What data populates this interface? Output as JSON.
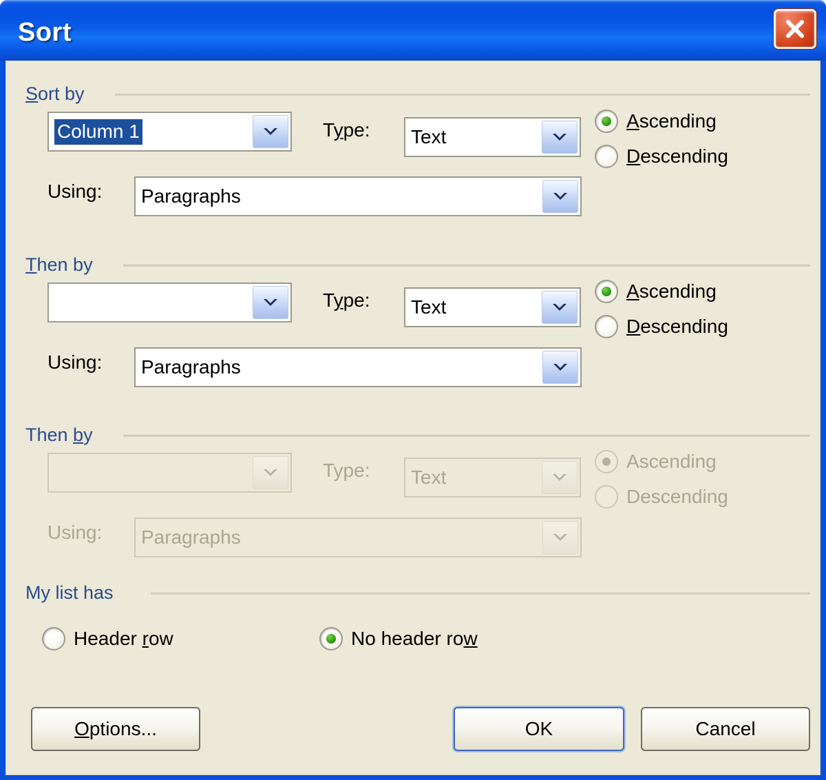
{
  "window": {
    "title": "Sort",
    "close_icon": "close-icon"
  },
  "groups": {
    "sort_by": {
      "label_pre": "S",
      "label_post": "ort by",
      "field_value": "Column 1",
      "field_selected": true,
      "type_label_pre": "T",
      "type_label_mid": "y",
      "type_label_post": "pe:",
      "type_value": "Text",
      "using_label": "Using:",
      "using_value": "Paragraphs",
      "ascending_pre": "A",
      "ascending_post": "scending",
      "descending_pre": "D",
      "descending_post": "escending",
      "order_selected": "Ascending"
    },
    "then_by_1": {
      "label_pre": "T",
      "label_post": "hen by",
      "field_value": "",
      "type_label_pre": "T",
      "type_label_mid": "y",
      "type_label_post": "pe:",
      "type_value": "Text",
      "using_label": "Using:",
      "using_value": "Paragraphs",
      "ascending_pre": "A",
      "ascending_post": "scending",
      "descending_pre": "D",
      "descending_post": "escending",
      "order_selected": "Ascending"
    },
    "then_by_2": {
      "label_pre": "Then ",
      "label_mid": "b",
      "label_post": "y",
      "field_value": "",
      "type_label": "Type:",
      "type_value": "Text",
      "using_label": "Using:",
      "using_value": "Paragraphs",
      "ascending_label": "Ascending",
      "descending_label": "Descending",
      "order_selected": "Ascending",
      "enabled": false
    },
    "my_list_has": {
      "label": "My list has",
      "header_row_pre": "Header ",
      "header_row_mid": "r",
      "header_row_post": "ow",
      "no_header_row_pre": "No header ro",
      "no_header_row_mid": "w",
      "selected": "No header row"
    }
  },
  "buttons": {
    "options_pre": "O",
    "options_post": "ptions...",
    "ok": "OK",
    "cancel": "Cancel",
    "default_button": "OK"
  },
  "colors": {
    "titlebar_blue": "#0a50d8",
    "dialog_face": "#ece9d8",
    "group_label_blue": "#2a4b8d",
    "selection_blue": "#1c4f9c",
    "radio_green": "#35a019",
    "close_red": "#cf3d18",
    "disabled_text": "#aaa694"
  }
}
